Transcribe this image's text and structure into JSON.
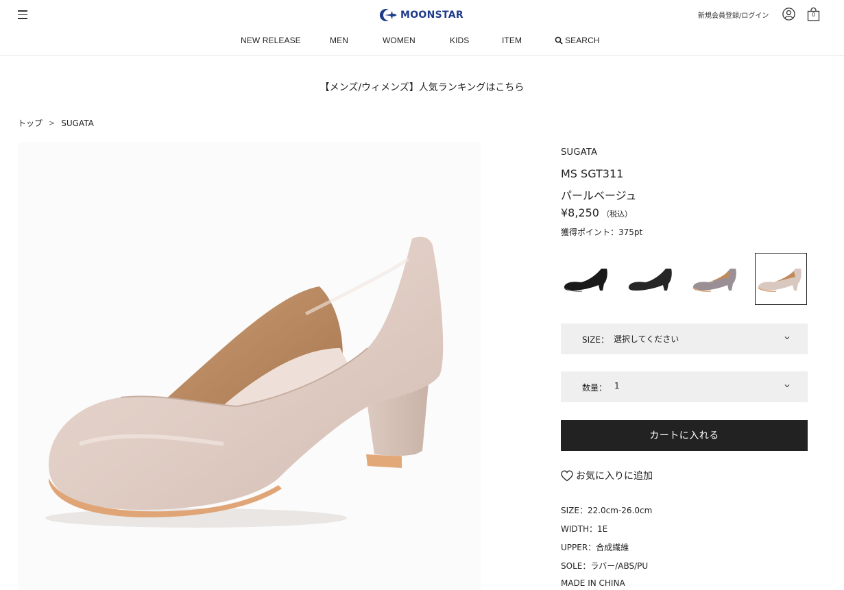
{
  "header": {
    "logo_text": "MOONSTAR",
    "login_label": "新規会員登録/ログイン",
    "cart_count": "0",
    "brand_color": "#1e3a8a"
  },
  "nav": {
    "items": [
      {
        "label": "NEW RELEASE"
      },
      {
        "label": "MEN"
      },
      {
        "label": "WOMEN"
      },
      {
        "label": "KIDS"
      },
      {
        "label": "ITEM"
      },
      {
        "label": "SEARCH"
      }
    ]
  },
  "banner": {
    "text": "【メンズ/ウィメンズ】人気ランキングはこちら"
  },
  "breadcrumb": {
    "items": [
      {
        "label": "トップ"
      },
      {
        "label": "SUGATA"
      }
    ],
    "separator": ">"
  },
  "product": {
    "brand": "SUGATA",
    "model": "MS SGT311",
    "color_name": "パールベージュ",
    "price": "¥8,250",
    "tax_note": "（税込）",
    "points": "獲得ポイント：375pt",
    "variants": [
      {
        "color": "#1a1a1a",
        "name": "black-leather"
      },
      {
        "color": "#222222",
        "name": "black-suede"
      },
      {
        "color": "#9a8f94",
        "name": "grey"
      },
      {
        "color": "#d9c8c0",
        "name": "pearl-beige",
        "selected": true
      }
    ],
    "size": {
      "label": "SIZE：",
      "value": "選択してください"
    },
    "quantity": {
      "label": "数量：",
      "value": "1"
    },
    "cart_button": "カートに入れる",
    "favorite": "お気に入りに追加",
    "specs": [
      "SIZE：22.0cm-26.0cm",
      "WIDTH：1E",
      "UPPER：合成繊維",
      "SOLE：ラバー/ABS/PU",
      "MADE IN CHINA"
    ]
  }
}
